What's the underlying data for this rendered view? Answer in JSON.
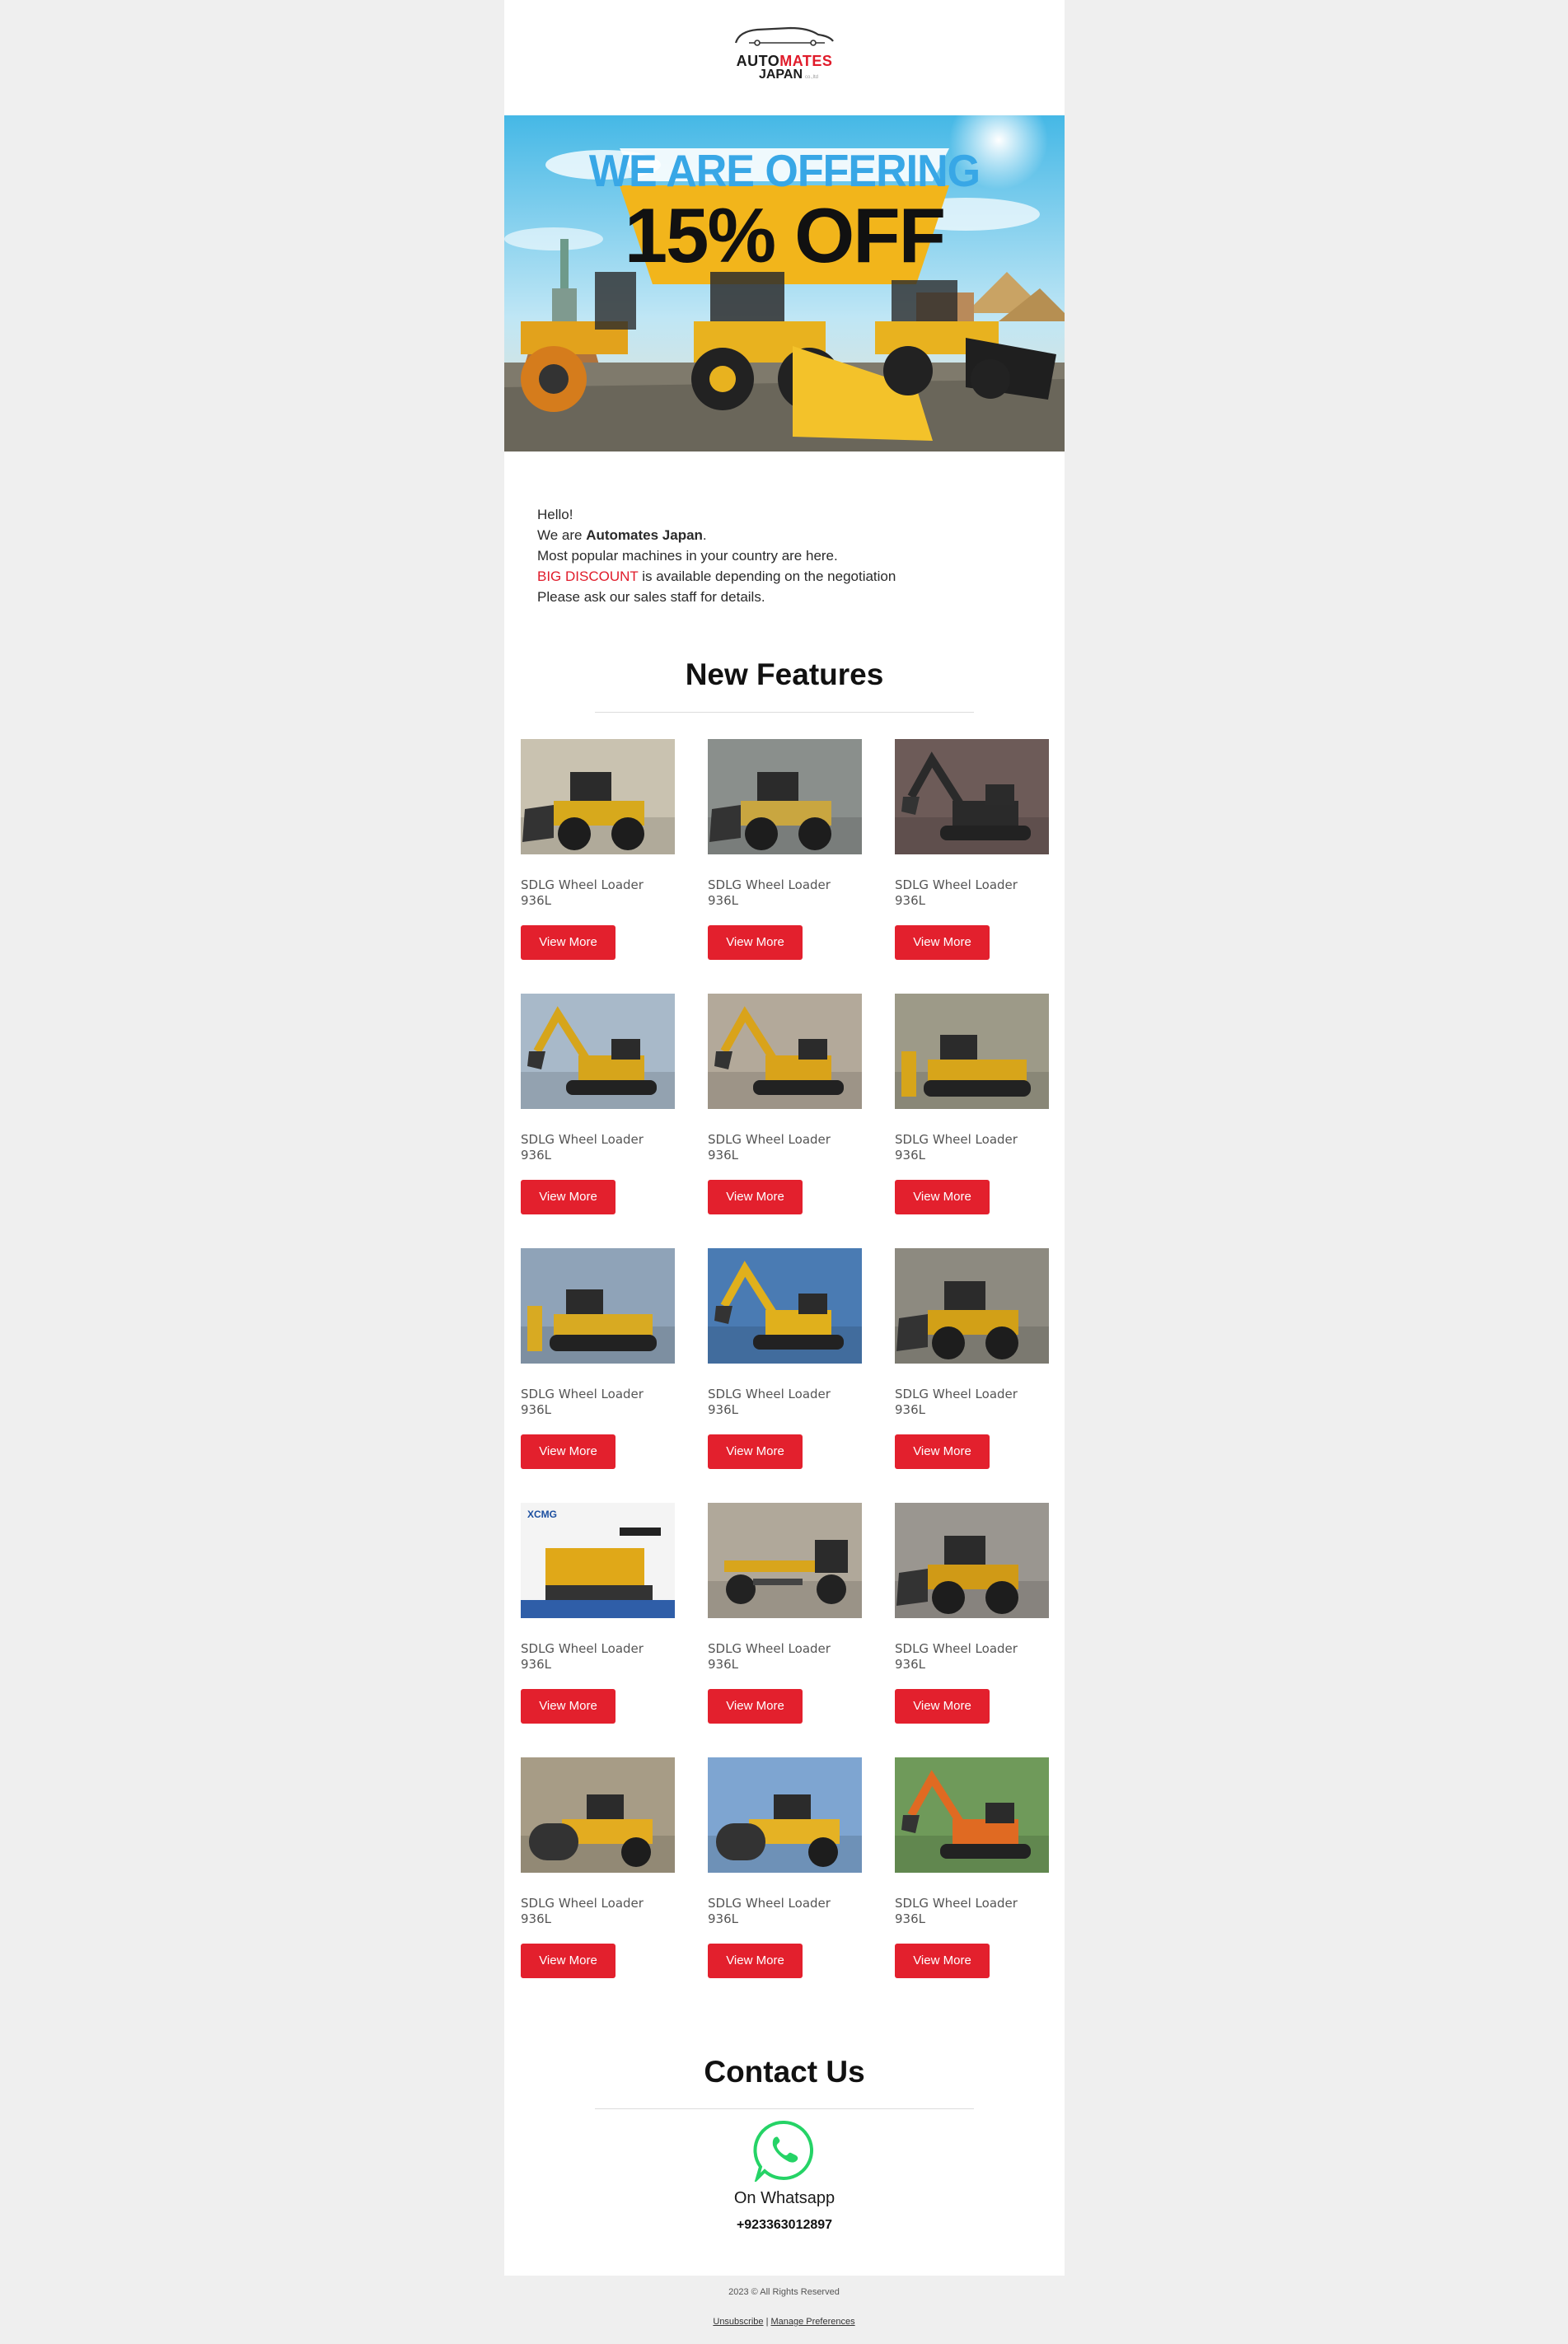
{
  "logo": {
    "line1_a": "AUTO",
    "line1_b": "MATES",
    "line2": "JAPAN",
    "line2_small": "co.,ltd"
  },
  "hero": {
    "line1": "WE ARE OFFERING",
    "line2": "15% OFF"
  },
  "intro": {
    "greeting": "Hello!",
    "we_are_prefix": "We are ",
    "company": "Automates Japan",
    "we_are_suffix": ".",
    "line3": "Most popular machines in your country are here.",
    "discount_highlight": "BIG DISCOUNT",
    "discount_rest": " is available depending on the negotiation",
    "line5": "Please ask our sales staff for details."
  },
  "features": {
    "title": "New Features",
    "items": [
      {
        "title": "SDLG Wheel Loader 936L",
        "button": "View More",
        "kind": "loader",
        "bg": "#c9c2b0",
        "machine": "#d7a91c"
      },
      {
        "title": "SDLG Wheel Loader 936L",
        "button": "View More",
        "kind": "loader",
        "bg": "#8a8f8c",
        "machine": "#c9a640"
      },
      {
        "title": "SDLG Wheel Loader 936L",
        "button": "View More",
        "kind": "excavator",
        "bg": "#6d5b58",
        "machine": "#2a2a2a"
      },
      {
        "title": "SDLG Wheel Loader 936L",
        "button": "View More",
        "kind": "excavator",
        "bg": "#a8b9c9",
        "machine": "#d6a51b"
      },
      {
        "title": "SDLG Wheel Loader 936L",
        "button": "View More",
        "kind": "excavator",
        "bg": "#b3a99a",
        "machine": "#d9a31a"
      },
      {
        "title": "SDLG Wheel Loader 936L",
        "button": "View More",
        "kind": "dozer",
        "bg": "#9d9a88",
        "machine": "#d7a51a"
      },
      {
        "title": "SDLG Wheel Loader 936L",
        "button": "View More",
        "kind": "dozer",
        "bg": "#8fa3b8",
        "machine": "#d8aa22"
      },
      {
        "title": "SDLG Wheel Loader 936L",
        "button": "View More",
        "kind": "excavator",
        "bg": "#4a7bb3",
        "machine": "#e0b01c"
      },
      {
        "title": "SDLG Wheel Loader 936L",
        "button": "View More",
        "kind": "loader",
        "bg": "#8d8a80",
        "machine": "#d2a017"
      },
      {
        "title": "SDLG Wheel Loader 936L",
        "button": "View More",
        "kind": "paver",
        "bg": "#ffffff",
        "machine": "#e0a818"
      },
      {
        "title": "SDLG Wheel Loader 936L",
        "button": "View More",
        "kind": "grader",
        "bg": "#b0a89a",
        "machine": "#d8a51c"
      },
      {
        "title": "SDLG Wheel Loader 936L",
        "button": "View More",
        "kind": "loader",
        "bg": "#9a9690",
        "machine": "#d09a16"
      },
      {
        "title": "SDLG Wheel Loader 936L",
        "button": "View More",
        "kind": "roller",
        "bg": "#a79c86",
        "machine": "#e3ac20"
      },
      {
        "title": "SDLG Wheel Loader 936L",
        "button": "View More",
        "kind": "roller",
        "bg": "#7ea5d1",
        "machine": "#e5b224"
      },
      {
        "title": "SDLG Wheel Loader 936L",
        "button": "View More",
        "kind": "excavator",
        "bg": "#6f9a5a",
        "machine": "#e06a22"
      }
    ]
  },
  "contact": {
    "title": "Contact Us",
    "whatsapp_label": "On Whatsapp",
    "phone": "+923363012897"
  },
  "footer": {
    "copyright": "2023 © All Rights Reserved",
    "unsubscribe": "Unsubscribe",
    "separator": " | ",
    "preferences": "Manage Preferences"
  },
  "colors": {
    "accent": "#e3202d",
    "whatsapp": "#25d366"
  }
}
